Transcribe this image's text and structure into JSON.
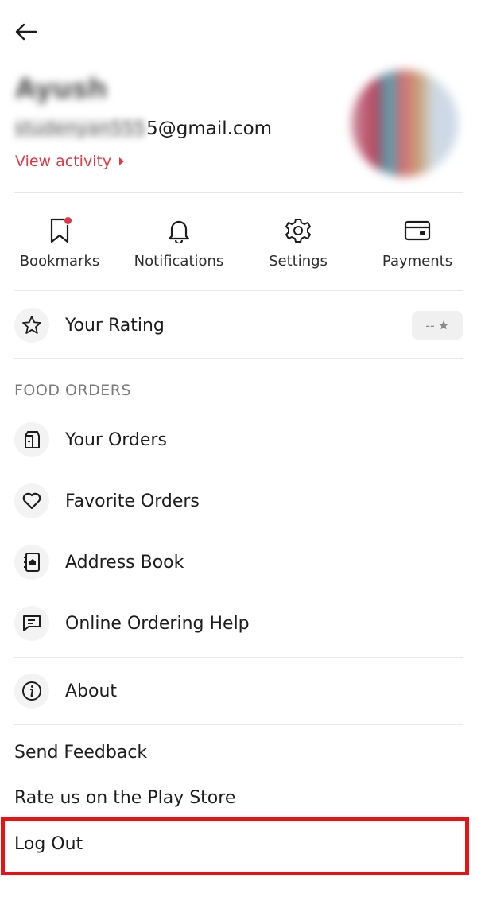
{
  "header": {
    "back_icon": "arrow-left-icon"
  },
  "profile": {
    "name": "Ayush",
    "email_hidden": "studenyan555",
    "email_domain": "5@gmail.com",
    "view_activity": "View activity"
  },
  "quick_actions": [
    {
      "label": "Bookmarks",
      "icon": "bookmark-icon",
      "has_badge": true
    },
    {
      "label": "Notifications",
      "icon": "bell-icon"
    },
    {
      "label": "Settings",
      "icon": "gear-icon"
    },
    {
      "label": "Payments",
      "icon": "card-icon"
    }
  ],
  "rating": {
    "label": "Your Rating",
    "value": "--"
  },
  "food_orders": {
    "title": "FOOD ORDERS",
    "items": [
      {
        "label": "Your Orders",
        "icon": "orders-bag-icon"
      },
      {
        "label": "Favorite Orders",
        "icon": "heart-icon"
      },
      {
        "label": "Address Book",
        "icon": "address-book-icon"
      },
      {
        "label": "Online Ordering Help",
        "icon": "chat-icon"
      }
    ]
  },
  "about": {
    "label": "About",
    "icon": "info-icon"
  },
  "links": {
    "send_feedback": "Send Feedback",
    "rate_us": "Rate us on the Play Store",
    "log_out": "Log Out"
  },
  "colors": {
    "accent": "#e23744",
    "highlight_box": "#ee1010"
  }
}
